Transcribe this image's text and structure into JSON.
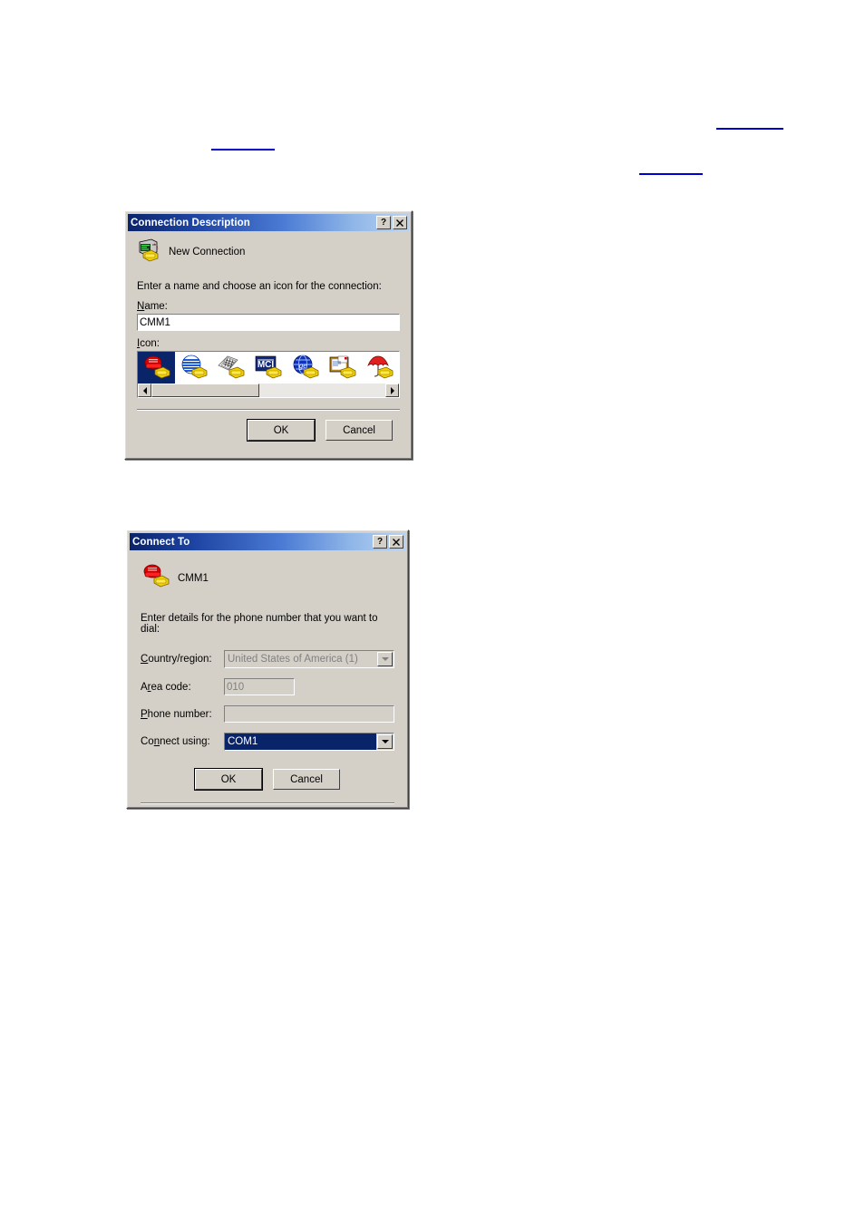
{
  "page": {
    "background": "#ffffff",
    "link_color": "#0000cc",
    "dialog_face": "#d4d0c8",
    "titlebar_start": "#0a246a",
    "titlebar_end": "#b9d2f2",
    "selection_blue": "#0a246a"
  },
  "links": [
    {
      "name": "link-top-right",
      "text": ""
    },
    {
      "name": "link-mid-right",
      "text": ""
    },
    {
      "name": "link-left",
      "text": ""
    }
  ],
  "connection_description": {
    "title": "Connection Description",
    "help_button": "?",
    "close_button": "✕",
    "header_icon": "new-connection-modem-icon",
    "header_caption": "New Connection",
    "prompt": "Enter a name and choose an icon for the connection:",
    "name_label": "Name:",
    "name_label_accel": "N",
    "name_label_rest": "ame:",
    "name_value": "CMM1",
    "icon_label": "Icon:",
    "icon_label_accel": "I",
    "icon_label_rest": "con:",
    "icons": [
      {
        "name": "icon-red-telephone",
        "selected": true
      },
      {
        "name": "icon-blue-globe-stripes",
        "selected": false
      },
      {
        "name": "icon-checkered-pages",
        "selected": false
      },
      {
        "name": "icon-mci-logo",
        "selected": false
      },
      {
        "name": "icon-ge-globe",
        "selected": false
      },
      {
        "name": "icon-notepad-documents",
        "selected": false
      },
      {
        "name": "icon-red-umbrella",
        "selected": false
      }
    ],
    "scroll_left_arrow": "◄",
    "scroll_right_arrow": "►",
    "ok_label": "OK",
    "cancel_label": "Cancel"
  },
  "connect_to": {
    "title": "Connect To",
    "help_button": "?",
    "close_button": "✕",
    "header_icon": "red-telephone-modem-icon",
    "header_caption": "CMM1",
    "prompt": "Enter details for the phone number that you want to dial:",
    "fields": [
      {
        "name": "country-region",
        "label": "Country/region:",
        "label_accel": "C",
        "label_rest": "ountry/region:",
        "value": "United States of America (1)",
        "control": "combo",
        "disabled": true,
        "selected": false
      },
      {
        "name": "area-code",
        "label": "Area code:",
        "label_accel": "r",
        "label_pre": "A",
        "label_rest": "ea code:",
        "value": "010",
        "control": "textbox",
        "disabled": true,
        "width": 78
      },
      {
        "name": "phone-number",
        "label": "Phone number:",
        "label_accel": "P",
        "label_rest": "hone number:",
        "value": "",
        "control": "textbox",
        "disabled": true,
        "width": 198
      },
      {
        "name": "connect-using",
        "label": "Connect using:",
        "label_pre": "Co",
        "label_accel": "n",
        "label_rest": "nect using:",
        "value": "COM1",
        "control": "combo",
        "disabled": false,
        "selected": true
      }
    ],
    "ok_label": "OK",
    "cancel_label": "Cancel"
  }
}
